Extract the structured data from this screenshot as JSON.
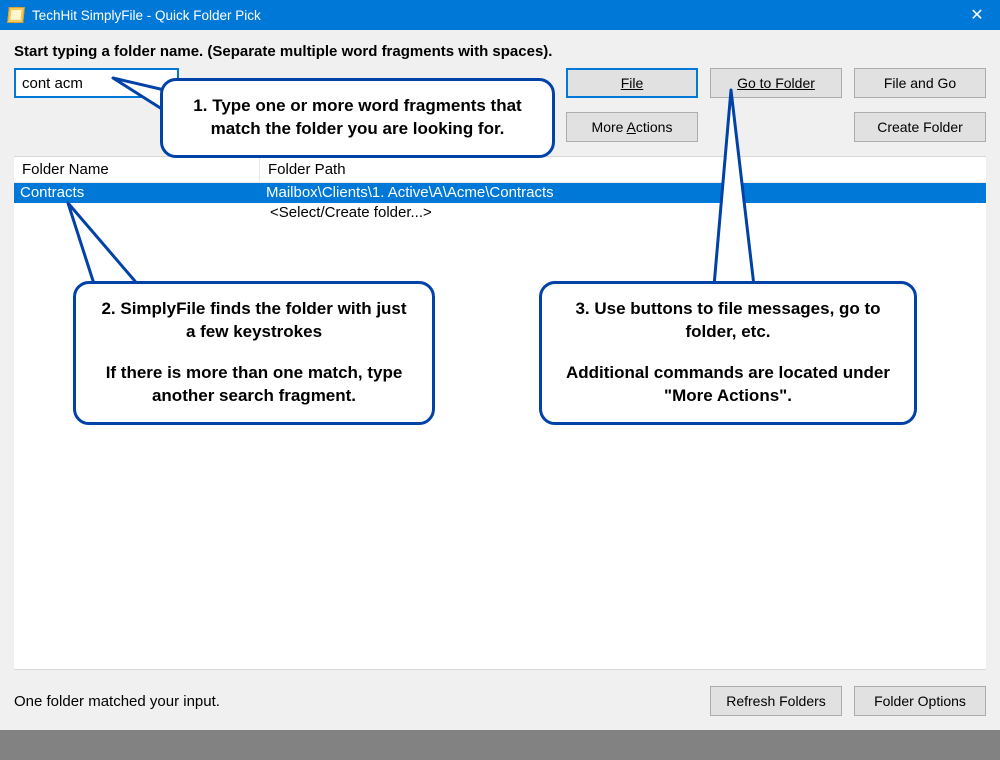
{
  "colors": {
    "accent": "#0078d7",
    "calloutBorder": "#0042a7"
  },
  "titlebar": {
    "title": "TechHit SimplyFile - Quick Folder Pick"
  },
  "instruction": "Start typing a folder name. (Separate multiple word fragments with spaces).",
  "search": {
    "value": "cont acm"
  },
  "buttons": {
    "file": "File",
    "goToFolder": "Go to Folder",
    "fileAndGo": "File and Go",
    "moreActions_pre": "More ",
    "moreActions_u": "A",
    "moreActions_post": "ctions",
    "createFolder": "Create Folder",
    "refreshFolders": "Refresh Folders",
    "folderOptions": "Folder Options"
  },
  "columns": {
    "name": "Folder Name",
    "path": "Folder Path"
  },
  "rows": {
    "selected": {
      "name": "Contracts",
      "path": "Mailbox\\Clients\\1. Active\\A\\Acme\\Contracts"
    },
    "placeholder": "<Select/Create folder...>"
  },
  "status": "One folder matched your input.",
  "callouts": {
    "c1": "1. Type one or more word fragments that match the folder you are looking for.",
    "c2a": "2. SimplyFile finds the folder with just a few keystrokes",
    "c2b": "If there is more than one match, type another search fragment.",
    "c3a": "3. Use buttons to file messages, go to folder, etc.",
    "c3b": "Additional commands are located under \"More Actions\"."
  }
}
